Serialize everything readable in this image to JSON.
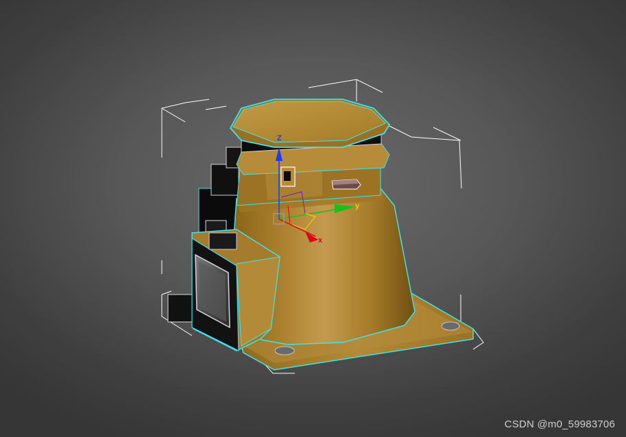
{
  "viewport": {
    "gizmo": {
      "z_label": "Z",
      "y_label": "y",
      "x_label": "x"
    },
    "colors": {
      "model_body": "#b98f3a",
      "selection_outline": "#39e6f0",
      "bbox_lines": "#ffffff",
      "axis_x": "#e0001a",
      "axis_y": "#19c019",
      "axis_z": "#1a3aff"
    }
  },
  "watermark": "CSDN @m0_59983706"
}
